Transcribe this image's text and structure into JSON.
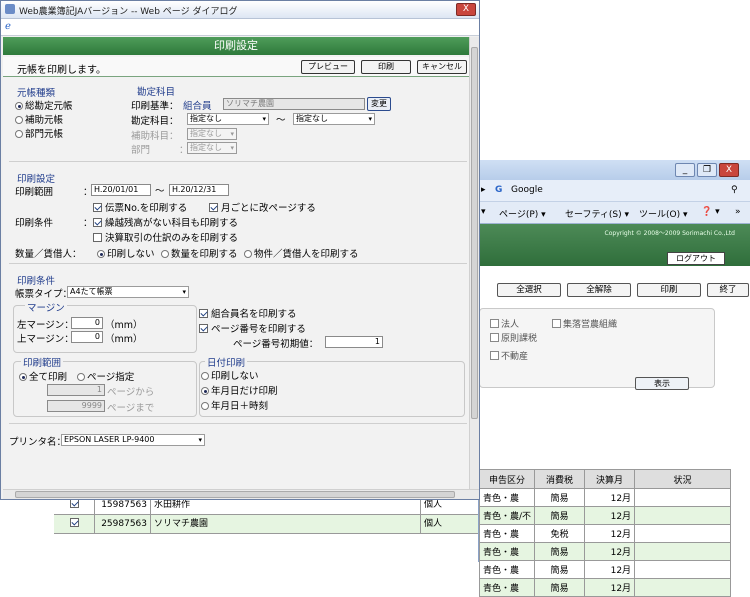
{
  "dialog": {
    "window_title": "Web農業簿記JAバージョン -- Web ページ ダイアログ",
    "close_label": "X",
    "header_title": "印刷設定",
    "subheader": "元帳を印刷します。",
    "buttons": {
      "preview": "プレビュー",
      "print": "印刷",
      "cancel": "キャンセル"
    },
    "ledger_type": {
      "title": "元帳種類",
      "options": [
        "総勘定元帳",
        "補助元帳",
        "部門元帳"
      ]
    },
    "account": {
      "title": "勘定科目",
      "basis_label": "印刷基準：",
      "basis_value": "組合員",
      "basis_field": "ソリマチ農園",
      "change_button": "変更",
      "account_label": "勘定科目：",
      "account_from": "指定なし",
      "tilde": "〜",
      "account_to": "指定なし",
      "sub_label": "補助科目：",
      "sub_value": "指定なし",
      "dept_label": "部門",
      "dept_colon": "：",
      "dept_value": "指定なし"
    },
    "print_settings": {
      "title": "印刷設定",
      "range_label": "印刷範囲",
      "colon": "：",
      "date_from": "H.20/01/01",
      "tilde": "〜",
      "date_to": "H.20/12/31",
      "slip_no": "伝票No.を印刷する",
      "page_per_month": "月ごとに改ページする",
      "cond_label": "印刷条件",
      "carryover": "繰越残高がない科目も印刷する",
      "settlement": "決算取引の仕訳のみを印刷する",
      "qty_label": "数量／賃借人：",
      "qty_options": [
        "印刷しない",
        "数量を印刷する",
        "物件／賃借人を印刷する"
      ]
    },
    "print_conditions": {
      "title": "印刷条件",
      "form_type_label": "帳票タイプ：",
      "form_type_value": "A4たて帳票",
      "margin_title": "マージン",
      "left_margin_label": "左マージン：",
      "left_margin_value": "0",
      "top_margin_label": "上マージン：",
      "top_margin_value": "0",
      "unit": "（mm）",
      "print_member_name": "組合員名を印刷する",
      "print_page_number": "ページ番号を印刷する",
      "page_initial_label": "ページ番号初期値：",
      "page_initial_value": "1",
      "range_title": "印刷範囲",
      "range_all": "全て印刷",
      "range_pages": "ページ指定",
      "page_from_value": "1",
      "page_from_label": "ページから",
      "page_to_value": "9999",
      "page_to_label": "ページまで",
      "date_print_title": "日付印刷",
      "date_options": [
        "印刷しない",
        "年月日だけ印刷",
        "年月日＋時刻"
      ]
    },
    "printer": {
      "label": "プリンタ名：",
      "value": "EPSON LASER LP-9400"
    }
  },
  "background": {
    "window_buttons": [
      "_",
      "❐",
      "X"
    ],
    "search_text": "Google",
    "toolbar_items": [
      "ページ(P) ▾",
      "セーフティ(S) ▾",
      "ツール(O) ▾",
      "❓ ▾"
    ],
    "copyright": "Copyright © 2008～2009 Sorimachi Co.,Ltd",
    "logout": "ログアウト",
    "buttons": [
      "全選択",
      "全解除",
      "印刷",
      "終了"
    ],
    "filters": [
      "法人",
      "集落営農組織",
      "原則課税",
      "不動産"
    ],
    "show_button": "表示",
    "table": {
      "headers": [
        "申告区分",
        "消費税",
        "決算月",
        "状況"
      ],
      "rows": [
        [
          "青色・農",
          "簡易",
          "12月",
          ""
        ],
        [
          "青色・農/不",
          "簡易",
          "12月",
          ""
        ],
        [
          "青色・農",
          "免税",
          "12月",
          ""
        ],
        [
          "青色・農",
          "簡易",
          "12月",
          ""
        ],
        [
          "青色・農",
          "簡易",
          "12月",
          ""
        ],
        [
          "青色・農",
          "簡易",
          "12月",
          ""
        ]
      ]
    },
    "under_rows": [
      {
        "code": "15987563",
        "name": "水田耕作",
        "type": "個人"
      },
      {
        "code": "25987563",
        "name": "ソリマチ農園",
        "type": "個人"
      }
    ]
  }
}
